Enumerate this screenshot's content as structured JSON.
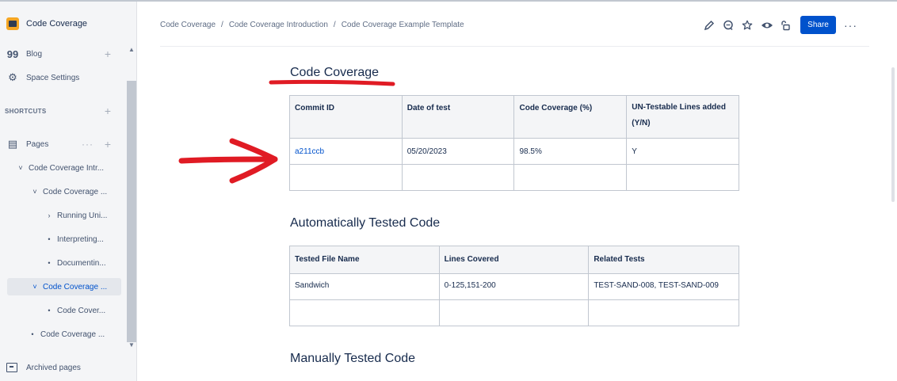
{
  "space": {
    "name": "Code Coverage"
  },
  "sidebar": {
    "blog": "Blog",
    "space_settings": "Space Settings",
    "shortcuts": "SHORTCUTS",
    "pages": "Pages",
    "tree": [
      {
        "label": "Code Coverage Intr...",
        "chevron": "˅"
      },
      {
        "label": "Code Coverage ...",
        "chevron": "˅"
      },
      {
        "label": "Running Uni...",
        "chevron": "›"
      },
      {
        "label": "Interpreting...",
        "chevron": "•"
      },
      {
        "label": "Documentin...",
        "chevron": "•"
      },
      {
        "label": "Code Coverage ...",
        "chevron": "˅"
      },
      {
        "label": "Code Cover...",
        "chevron": "•"
      },
      {
        "label": "Code Coverage ...",
        "chevron": "•"
      }
    ],
    "archived": "Archived pages"
  },
  "breadcrumb": {
    "items": [
      "Code Coverage",
      "Code Coverage Introduction",
      "Code Coverage Example Template"
    ],
    "separator": "/"
  },
  "header": {
    "share_label": "Share"
  },
  "content": {
    "title": "Code Coverage",
    "table1": {
      "headers": [
        "Commit ID",
        "Date of test",
        "Code Coverage (%)",
        "UN-Testable Lines added (Y/N)"
      ],
      "rows": [
        [
          "a211ccb",
          "05/20/2023",
          "98.5%",
          "Y"
        ],
        [
          "",
          "",
          "",
          ""
        ]
      ]
    },
    "section2": "Automatically Tested Code",
    "table2": {
      "headers": [
        "Tested File Name",
        "Lines Covered",
        "Related Tests"
      ],
      "rows": [
        [
          "Sandwich",
          "0-125,151-200",
          "TEST-SAND-008, TEST-SAND-009"
        ],
        [
          "",
          "",
          ""
        ]
      ]
    },
    "section3": "Manually Tested Code"
  },
  "colors": {
    "accent": "#0052cc",
    "annotation": "#e01b24",
    "sidebar_bg": "#f4f5f7"
  }
}
